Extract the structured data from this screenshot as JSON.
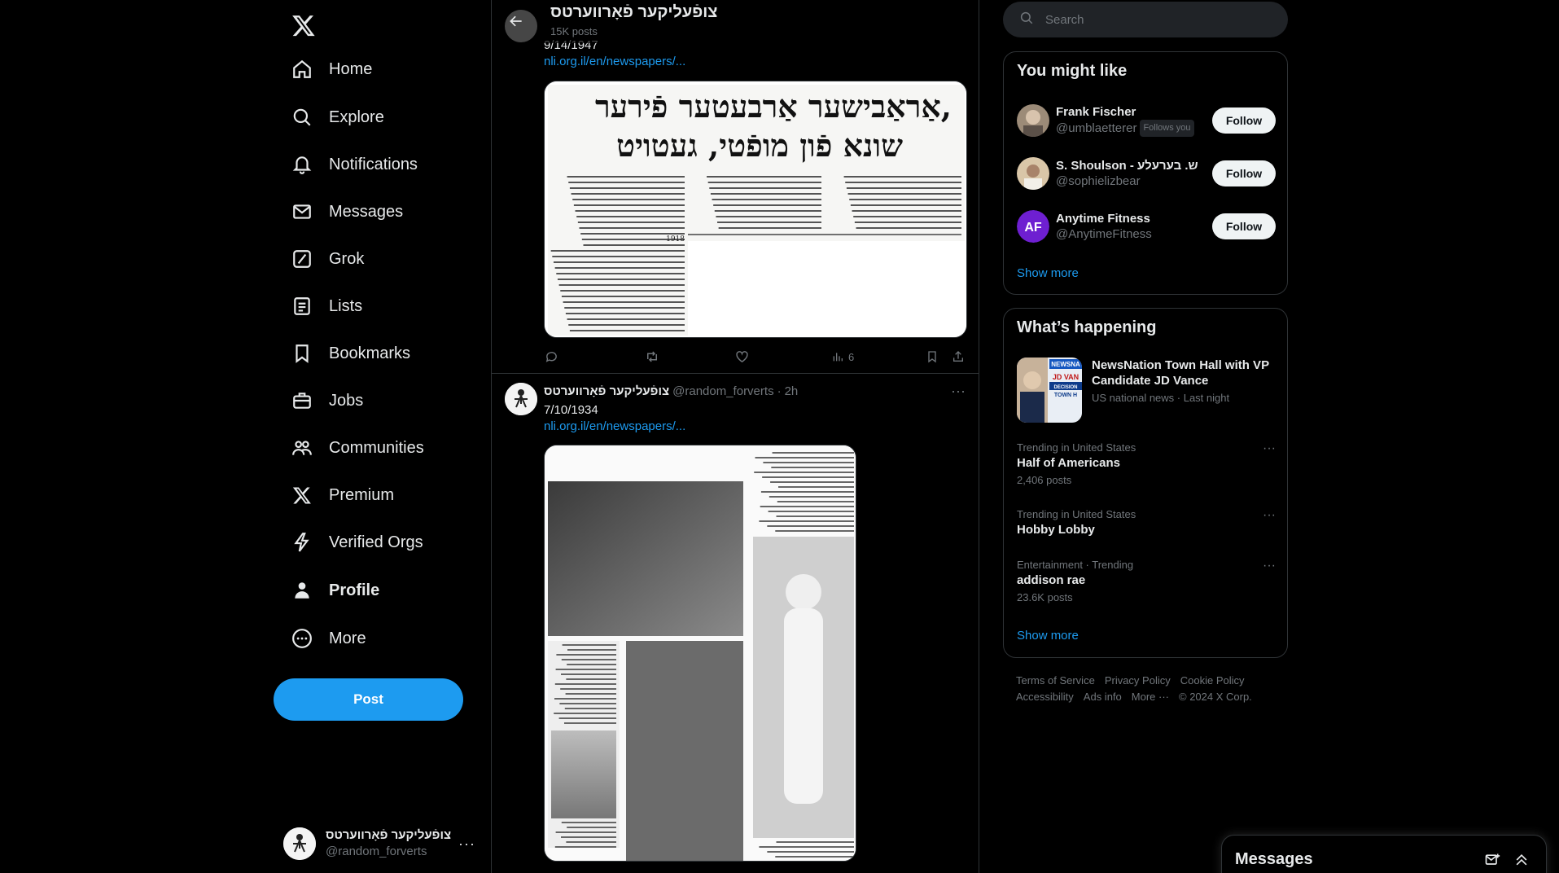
{
  "nav": {
    "items": [
      {
        "label": "Home",
        "icon": "home-icon"
      },
      {
        "label": "Explore",
        "icon": "search-icon"
      },
      {
        "label": "Notifications",
        "icon": "bell-icon"
      },
      {
        "label": "Messages",
        "icon": "mail-icon"
      },
      {
        "label": "Grok",
        "icon": "grok-icon"
      },
      {
        "label": "Lists",
        "icon": "list-icon"
      },
      {
        "label": "Bookmarks",
        "icon": "bookmark-icon"
      },
      {
        "label": "Jobs",
        "icon": "briefcase-icon"
      },
      {
        "label": "Communities",
        "icon": "people-icon"
      },
      {
        "label": "Premium",
        "icon": "x-icon"
      },
      {
        "label": "Verified Orgs",
        "icon": "lightning-icon"
      },
      {
        "label": "Profile",
        "icon": "person-icon"
      },
      {
        "label": "More",
        "icon": "more-circle-icon"
      }
    ],
    "post_label": "Post",
    "account": {
      "name": "צופֿעליקער פֿאָרווערטס",
      "handle": "@random_forverts"
    }
  },
  "header": {
    "title": "צופֿעליקער פֿאָרווערטס",
    "posts_count": "15K posts"
  },
  "tweet1": {
    "date_text": "9/14/1947",
    "link": "nli.org.il/en/newspapers/...",
    "views": "6",
    "headline_line1": "אַראַבישער אַרבעטער פֿירער,",
    "headline_line2": "שונא פֿון מופֿטי, געטויט",
    "date_line": "1918"
  },
  "tweet2": {
    "name": "צופֿעליקער פֿאָרווערטס",
    "handle": "@random_forverts",
    "time": "2h",
    "date_text": "7/10/1934",
    "link": "nli.org.il/en/newspapers/..."
  },
  "search": {
    "placeholder": "Search"
  },
  "who_to_follow": {
    "title": "You might like",
    "users": [
      {
        "name": "Frank Fischer",
        "handle": "@umblaetterer",
        "badge": "Follows you",
        "button": "Follow"
      },
      {
        "name": "S. Shoulson - ש. בערעלע",
        "handle": "@sophielizbear",
        "badge": "",
        "button": "Follow"
      },
      {
        "name": "Anytime Fitness",
        "handle": "@AnytimeFitness",
        "badge": "",
        "button": "Follow",
        "logo_text": "AF"
      }
    ],
    "show_more": "Show more"
  },
  "whats_happening": {
    "title": "What’s happening",
    "news": {
      "title": "NewsNation Town Hall with VP Candidate JD Vance",
      "meta": "US national news · Last night",
      "thumb_lines": [
        "NEWSNA",
        "JD VAN",
        "DECISION",
        "TOWN H"
      ]
    },
    "trends": [
      {
        "context": "Trending in United States",
        "title": "Half of Americans",
        "count": "2,406 posts"
      },
      {
        "context": "Trending in United States",
        "title": "Hobby Lobby",
        "count": ""
      },
      {
        "context": "Entertainment · Trending",
        "title": "addison rae",
        "count": "23.6K posts"
      }
    ],
    "show_more": "Show more"
  },
  "footer": {
    "links": [
      "Terms of Service",
      "Privacy Policy",
      "Cookie Policy",
      "Accessibility",
      "Ads info",
      "More ···",
      "© 2024 X Corp."
    ]
  },
  "messages_bar": {
    "title": "Messages"
  },
  "colors": {
    "accent": "#1d9bf0",
    "background": "#000000",
    "border": "#2f3336",
    "muted": "#71767b"
  }
}
